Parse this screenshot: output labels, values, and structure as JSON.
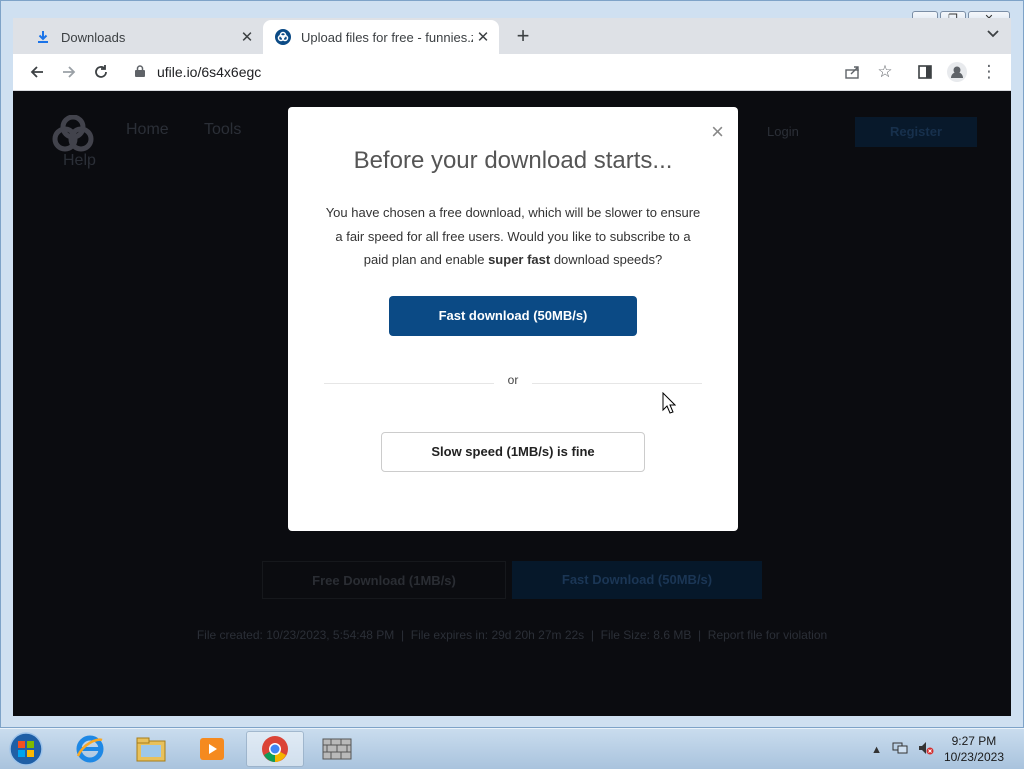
{
  "browser": {
    "tabs": [
      {
        "label": "Downloads",
        "icon": "download-icon"
      },
      {
        "label": "Upload files for free - funnies.zip - ufile.io",
        "icon": "ufile-logo-icon"
      }
    ],
    "url": "ufile.io/6s4x6egc"
  },
  "site": {
    "nav": {
      "home": "Home",
      "tools": "Tools",
      "help": "Help",
      "login": "Login",
      "register": "Register"
    },
    "buttons": {
      "free": "Free Download (1MB/s)",
      "fast": "Fast Download (50MB/s)"
    },
    "file_info": "File created: 10/23/2023, 5:54:48 PM  |  File expires in: 29d 20h 27m 22s  |  File Size: 8.6 MB  |  Report file for violation"
  },
  "modal": {
    "title": "Before your download starts...",
    "desc_pre": "You have chosen a free download, which will be slower to ensure a fair speed for all free users. Would you like to subscribe to a paid plan and enable ",
    "desc_bold": "super fast",
    "desc_post": " download speeds?",
    "fast_label": "Fast download (50MB/s)",
    "or_label": "or",
    "slow_label": "Slow speed (1MB/s) is fine",
    "close_label": "×"
  },
  "taskbar": {
    "time": "9:27 PM",
    "date": "10/23/2023"
  }
}
